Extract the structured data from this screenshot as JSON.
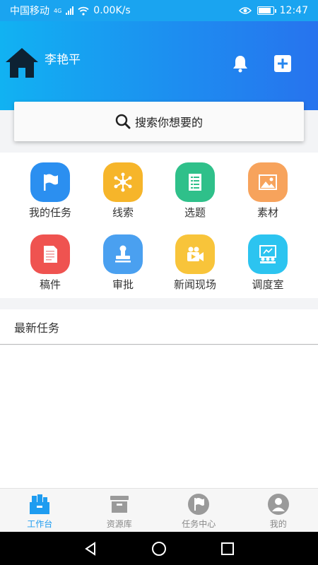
{
  "status_bar": {
    "carrier": "中国移动",
    "network_type": "4G",
    "speed": "0.00K/s",
    "time": "12:47",
    "battery_level": 0.9
  },
  "header": {
    "username": "李艳平"
  },
  "search": {
    "placeholder": "搜索你想要的"
  },
  "grid": {
    "items": [
      {
        "label": "我的任务",
        "color": "#2b8ff0",
        "icon": "flag-icon"
      },
      {
        "label": "线索",
        "color": "#f6b52a",
        "icon": "network-icon"
      },
      {
        "label": "选题",
        "color": "#2fc08a",
        "icon": "list-doc-icon"
      },
      {
        "label": "素材",
        "color": "#f7a35c",
        "icon": "image-icon"
      },
      {
        "label": "稿件",
        "color": "#ef5350",
        "icon": "document-icon"
      },
      {
        "label": "审批",
        "color": "#4aa0f0",
        "icon": "stamp-icon"
      },
      {
        "label": "新闻现场",
        "color": "#f8c43a",
        "icon": "video-camera-icon"
      },
      {
        "label": "调度室",
        "color": "#2cc4f0",
        "icon": "meeting-icon"
      }
    ]
  },
  "recent": {
    "title": "最新任务"
  },
  "bottom_nav": {
    "items": [
      {
        "label": "工作台",
        "icon": "workbench-icon",
        "active": true
      },
      {
        "label": "资源库",
        "icon": "archive-box-icon",
        "active": false
      },
      {
        "label": "任务中心",
        "icon": "task-flag-icon",
        "active": false
      },
      {
        "label": "我的",
        "icon": "user-avatar-icon",
        "active": false
      }
    ]
  },
  "colors": {
    "accent": "#1e9cf0",
    "header_start": "#11b2f2",
    "header_end": "#2773ee"
  }
}
